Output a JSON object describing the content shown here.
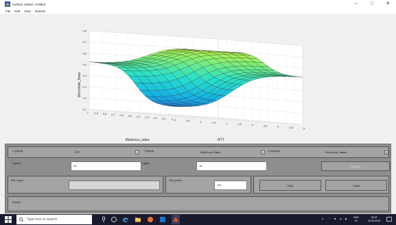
{
  "window": {
    "title": "Surface Viewer: Untitled",
    "menu": [
      "File",
      "Edit",
      "View",
      "Options"
    ]
  },
  "chart_data": {
    "type": "surface",
    "xlabel": "Malicious_rates",
    "ylabel": "RTT",
    "zlabel": "Wormhole_flows",
    "x_ticks": [
      "1",
      "0.9",
      "0.8",
      "0.7",
      "0.6",
      "0.5",
      "0.4",
      "0.3",
      "0.2",
      "0.1",
      "0"
    ],
    "y_ticks": [
      "0",
      "0.5",
      "1",
      "1.5",
      "2",
      "2.5",
      "3",
      "3.5",
      "4",
      "4.5",
      "5"
    ],
    "z_ticks": [
      "0.1",
      "0.2",
      "0.3",
      "0.4",
      "0.5",
      "0.6",
      "0.7",
      "0.8"
    ],
    "zlim": [
      0.1,
      0.8
    ],
    "colormap": [
      "#2b5cd8",
      "#16b3e6",
      "#2ae0c8",
      "#8ef06a",
      "#f0f020"
    ]
  },
  "controls": {
    "x_input_label": "X (input):",
    "x_input_value": "RTT",
    "y_input_label": "Y (input):",
    "y_input_value": "Malicious_Rates",
    "z_output_label": "Z (output):",
    "z_output_value": "Wormhole_attack",
    "x_grids_label": "X grids:",
    "x_grids_value": "15",
    "y_grids_label": "Y grids:",
    "y_grids_value": "15",
    "evaluate_label": "Evaluate",
    "ref_input_label": "Ref. Input:",
    "ref_input_value": "",
    "plot_points_label": "Plot points:",
    "plot_points_value": "101",
    "help_label": "Help",
    "close_label": "Close",
    "status": "Ready"
  },
  "taskbar": {
    "search_placeholder": "Type here to search",
    "tray_lang": "ENG",
    "tray_region": "IN",
    "tray_time": "22:43",
    "tray_date": "30-05-2018"
  },
  "colors": {
    "panel": "#8e8e8e",
    "taskbar": "#1a1a2e",
    "accent": "#0078d7"
  }
}
